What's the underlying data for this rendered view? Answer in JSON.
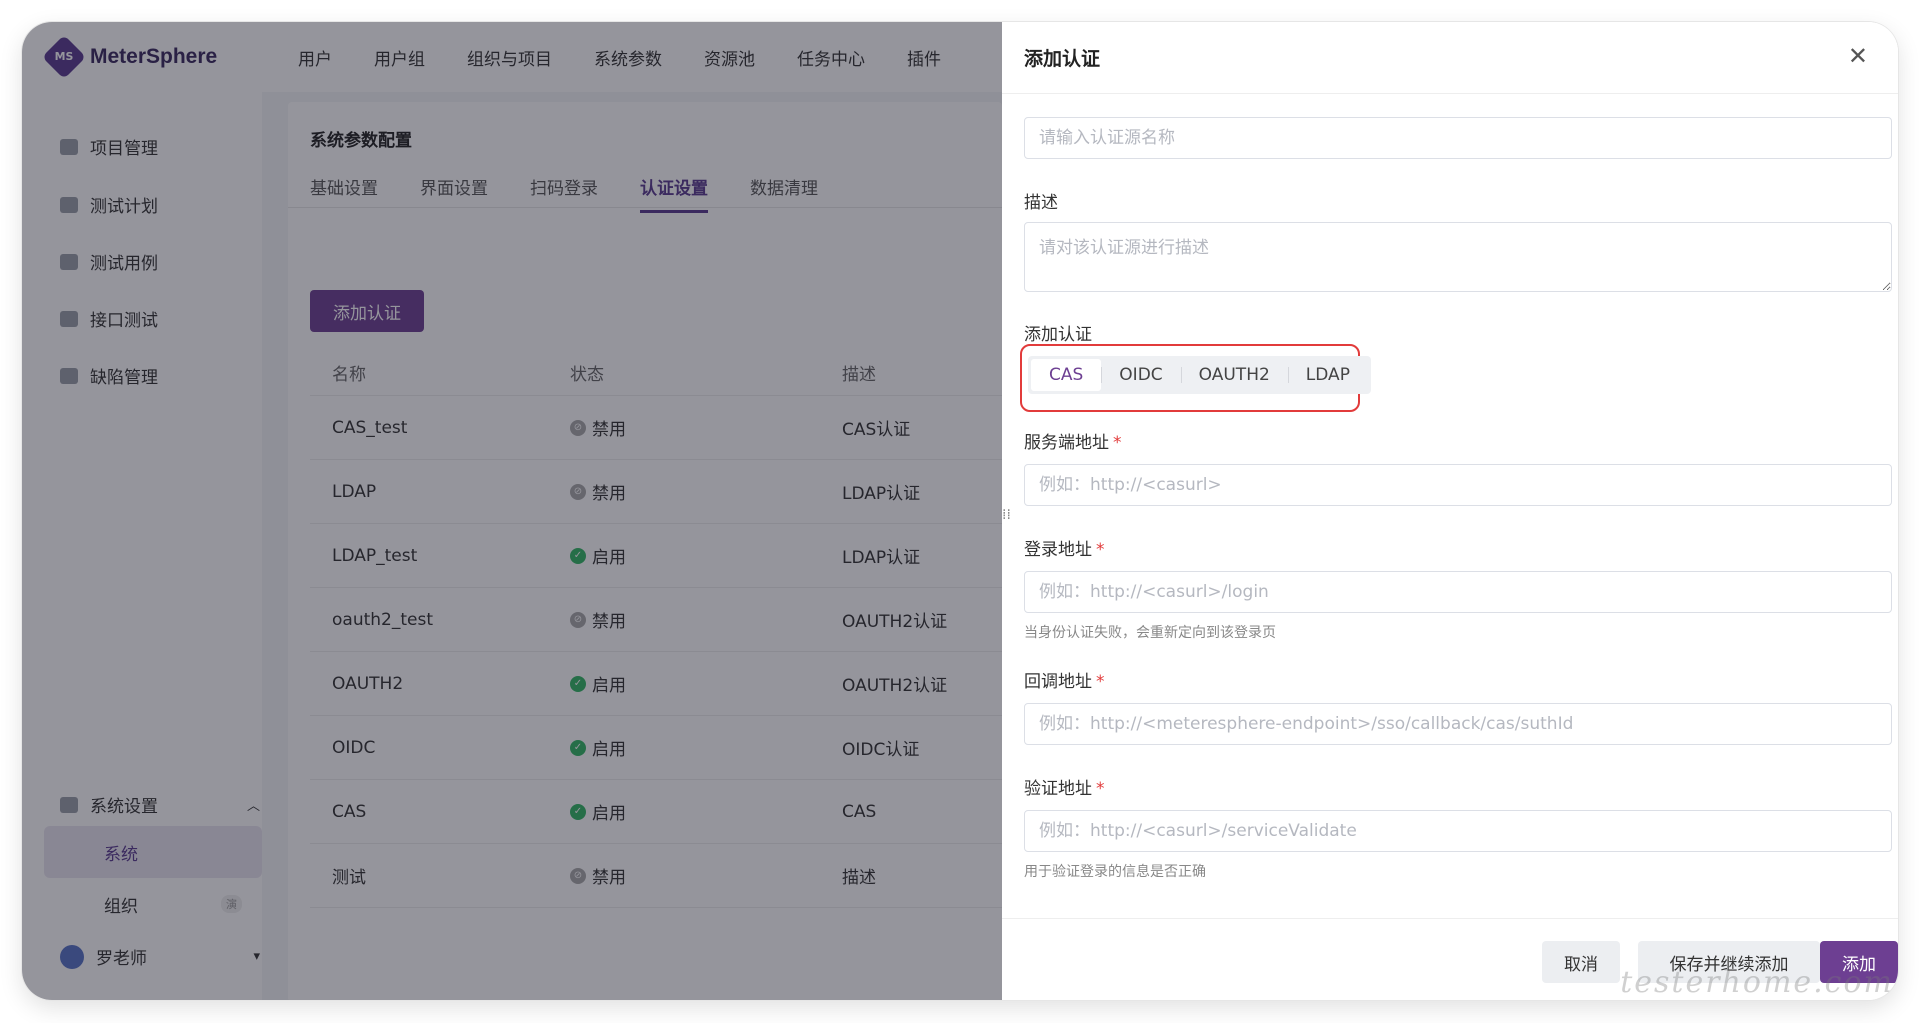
{
  "app": {
    "logo_mark": "MS",
    "name": "MeterSphere"
  },
  "topnav": [
    "用户",
    "用户组",
    "组织与项目",
    "系统参数",
    "资源池",
    "任务中心",
    "插件"
  ],
  "sidebar": {
    "items": [
      {
        "label": "项目管理",
        "icon": "project-icon"
      },
      {
        "label": "测试计划",
        "icon": "plan-icon"
      },
      {
        "label": "测试用例",
        "icon": "case-icon"
      },
      {
        "label": "接口测试",
        "icon": "api-icon"
      },
      {
        "label": "缺陷管理",
        "icon": "bug-icon"
      }
    ],
    "settings_label": "系统设置",
    "sub_system": "系统",
    "sub_org": "组织",
    "sub_org_tag": "演",
    "user_name": "罗老师"
  },
  "main": {
    "title": "系统参数配置",
    "tabs": [
      "基础设置",
      "界面设置",
      "扫码登录",
      "认证设置",
      "数据清理"
    ],
    "active_tab": 3,
    "add_button": "添加认证",
    "table": {
      "headers": [
        "名称",
        "状态",
        "描述"
      ],
      "rows": [
        {
          "name": "CAS_test",
          "status": "禁用",
          "enabled": false,
          "desc": "CAS认证"
        },
        {
          "name": "LDAP",
          "status": "禁用",
          "enabled": false,
          "desc": "LDAP认证"
        },
        {
          "name": "LDAP_test",
          "status": "启用",
          "enabled": true,
          "desc": "LDAP认证"
        },
        {
          "name": "oauth2_test",
          "status": "禁用",
          "enabled": false,
          "desc": "OAUTH2认证"
        },
        {
          "name": "OAUTH2",
          "status": "启用",
          "enabled": true,
          "desc": "OAUTH2认证"
        },
        {
          "name": "OIDC",
          "status": "启用",
          "enabled": true,
          "desc": "OIDC认证"
        },
        {
          "name": "CAS",
          "status": "启用",
          "enabled": true,
          "desc": "CAS"
        },
        {
          "name": "测试",
          "status": "禁用",
          "enabled": false,
          "desc": "描述"
        }
      ]
    }
  },
  "drawer": {
    "title": "添加认证",
    "name_placeholder": "请输入认证源名称",
    "desc_label": "描述",
    "desc_placeholder": "请对该认证源进行描述",
    "auth_label": "添加认证",
    "auth_types": [
      "CAS",
      "OIDC",
      "OAUTH2",
      "LDAP"
    ],
    "auth_active": 0,
    "server_label": "服务端地址",
    "server_placeholder": "例如：http://<casurl>",
    "login_label": "登录地址",
    "login_placeholder": "例如：http://<casurl>/login",
    "login_hint": "当身份认证失败，会重新定向到该登录页",
    "callback_label": "回调地址",
    "callback_placeholder": "例如：http://<meteresphere-endpoint>/sso/callback/cas/suthId",
    "validate_label": "验证地址",
    "validate_placeholder": "例如：http://<casurl>/serviceValidate",
    "validate_hint": "用于验证登录的信息是否正确",
    "cancel": "取消",
    "save_continue": "保存并继续添加",
    "submit": "添加"
  },
  "watermark": "testerhome.com",
  "colors": {
    "brand": "#6d3f92",
    "enabled": "#33b864",
    "disabled": "#a8a8a8",
    "highlight_border": "#e23b3b"
  }
}
